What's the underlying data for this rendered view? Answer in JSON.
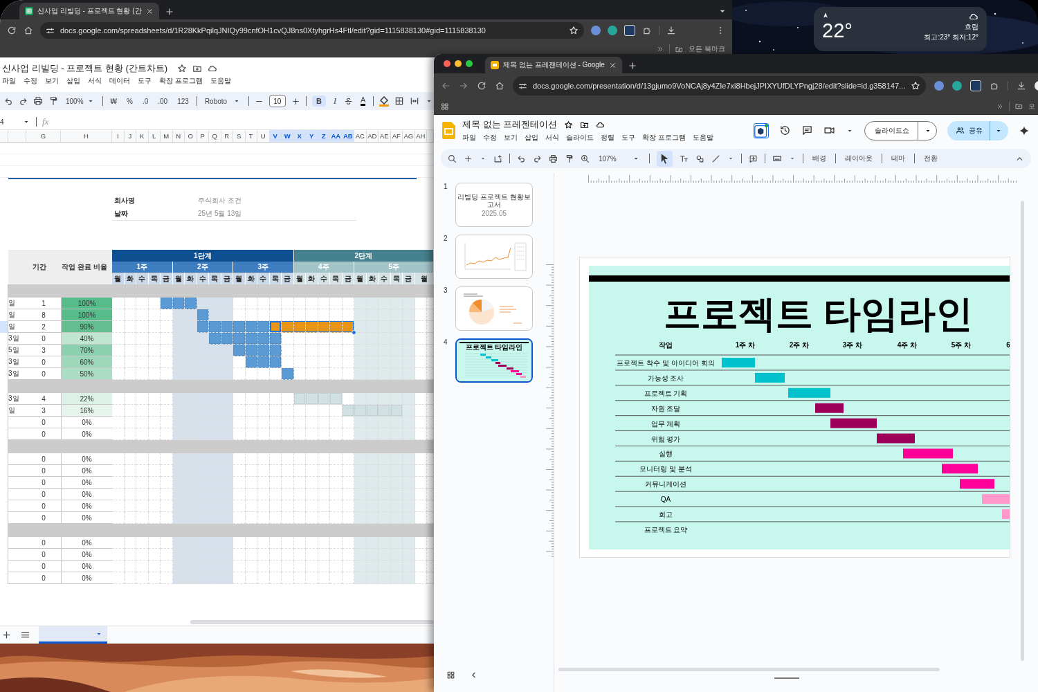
{
  "desktop": {
    "weather": {
      "temperature": "22°",
      "condition": "흐림",
      "range": "최고:23° 최저:12°"
    }
  },
  "sheets_window": {
    "tab_title": "신사업 리빌딩 - 프로젝트 현황 (간",
    "url": "docs.google.com/spreadsheets/d/1R28KkPqilqJNIQy99cnfOH1cvQJ8ns0XtyhgrHs4Ftl/edit?gid=1115838130#gid=1115838130",
    "bookmarks": "모든 북마크",
    "doc_title": "신사업 리빌딩 - 프로젝트 현황 (간트차트)",
    "menu": [
      "파일",
      "수정",
      "보기",
      "삽입",
      "서식",
      "데이터",
      "도구",
      "확장 프로그램",
      "도움말"
    ],
    "toolbar": {
      "zoom": "100%",
      "currency": "₩",
      "percent": "%",
      "decimal_decrease": ".0",
      "decimal_increase": ".00",
      "number_format": "123",
      "font": "Roboto",
      "font_size": "10",
      "bold": {
        "label": "B",
        "selected": true
      },
      "italic": {
        "label": "I",
        "selected": false
      },
      "text_color": "A"
    },
    "cell_ref": "4",
    "formula_label": "fx",
    "columns": [
      {
        "label": "G",
        "selected": false
      },
      {
        "label": "H",
        "selected": false
      },
      {
        "label": "I",
        "selected": false
      },
      {
        "label": "J",
        "selected": false
      },
      {
        "label": "K",
        "selected": false
      },
      {
        "label": "L",
        "selected": false
      },
      {
        "label": "M",
        "selected": false
      },
      {
        "label": "N",
        "selected": false
      },
      {
        "label": "O",
        "selected": false
      },
      {
        "label": "P",
        "selected": false
      },
      {
        "label": "Q",
        "selected": false
      },
      {
        "label": "R",
        "selected": false
      },
      {
        "label": "S",
        "selected": false
      },
      {
        "label": "T",
        "selected": false
      },
      {
        "label": "U",
        "selected": false
      },
      {
        "label": "V",
        "selected": true
      },
      {
        "label": "W",
        "selected": true
      },
      {
        "label": "X",
        "selected": true
      },
      {
        "label": "Y",
        "selected": true
      },
      {
        "label": "Z",
        "selected": true
      },
      {
        "label": "AA",
        "selected": true
      },
      {
        "label": "AB",
        "selected": true
      },
      {
        "label": "AC",
        "selected": false
      },
      {
        "label": "AD",
        "selected": false
      },
      {
        "label": "AE",
        "selected": false
      },
      {
        "label": "AF",
        "selected": false
      },
      {
        "label": "AG",
        "selected": false
      },
      {
        "label": "AH",
        "selected": false
      }
    ],
    "info": [
      {
        "label": "회사명",
        "value": "주식회사 조건"
      },
      {
        "label": "날짜",
        "value": "25년 5월 13일"
      }
    ],
    "gantt": {
      "duration_header": "기간",
      "progress_header": "작업 완료 비율",
      "phases": [
        {
          "label": "1단계",
          "color": "#0d4f91",
          "weeks": [
            {
              "label": "1주",
              "color": "#3d7dc0",
              "highlighted": false,
              "days": [
                "월",
                "화",
                "수",
                "목",
                "금"
              ]
            },
            {
              "label": "2주",
              "color": "#3d7dc0",
              "highlighted": true,
              "days": [
                "월",
                "화",
                "수",
                "목",
                "금"
              ]
            },
            {
              "label": "3주",
              "color": "#3d7dc0",
              "highlighted": false,
              "days": [
                "월",
                "화",
                "수",
                "목",
                "금"
              ]
            }
          ]
        },
        {
          "label": "2단계",
          "color": "#45818e",
          "weeks": [
            {
              "label": "4주",
              "color": "#a2c4c9",
              "highlighted": false,
              "days": [
                "월",
                "화",
                "수",
                "목",
                "금"
              ]
            },
            {
              "label": "5주",
              "color": "#a2c4c9",
              "highlighted": true,
              "days": [
                "월",
                "화",
                "수",
                "목",
                "금"
              ]
            },
            {
              "highlighted": false,
              "days": [
                "월"
              ]
            }
          ]
        }
      ],
      "rows": [
        {
          "kind": "section"
        },
        {
          "kind": "task",
          "date": "일",
          "duration": "1",
          "percent": "100%",
          "color": "#57bb8a",
          "selected": false,
          "cells": [
            {
              "filled": false
            },
            {
              "filled": false
            },
            {
              "filled": false
            },
            {
              "filled": false
            },
            {
              "filled": true,
              "color": "#5b9bd5"
            },
            {
              "filled": true,
              "color": "#5b9bd5"
            },
            {
              "filled": true,
              "color": "#5b9bd5"
            },
            {
              "filled": false
            },
            {
              "filled": false
            },
            {
              "filled": false
            },
            {
              "filled": false
            },
            {
              "filled": false
            },
            {
              "filled": false
            },
            {
              "filled": false
            },
            {
              "filled": false
            },
            {
              "filled": false
            },
            {
              "filled": false
            },
            {
              "filled": false
            },
            {
              "filled": false
            },
            {
              "filled": false
            },
            {
              "filled": false
            },
            {
              "filled": false
            },
            {
              "filled": false
            },
            {
              "filled": false
            },
            {
              "filled": false
            },
            {
              "filled": false
            }
          ]
        },
        {
          "kind": "task",
          "date": "일",
          "duration": "8",
          "percent": "100%",
          "color": "#57bb8a",
          "selected": false,
          "cells": [
            {
              "filled": false
            },
            {
              "filled": false
            },
            {
              "filled": false
            },
            {
              "filled": false
            },
            {
              "filled": false
            },
            {
              "filled": false
            },
            {
              "filled": false
            },
            {
              "filled": true,
              "color": "#5b9bd5"
            },
            {
              "filled": false
            },
            {
              "filled": false
            },
            {
              "filled": false
            },
            {
              "filled": false
            },
            {
              "filled": false
            },
            {
              "filled": false
            },
            {
              "filled": false
            },
            {
              "filled": false
            },
            {
              "filled": false
            },
            {
              "filled": false
            },
            {
              "filled": false
            },
            {
              "filled": false
            },
            {
              "filled": false
            },
            {
              "filled": false
            },
            {
              "filled": false
            },
            {
              "filled": false
            },
            {
              "filled": false
            },
            {
              "filled": false
            }
          ]
        },
        {
          "kind": "task",
          "date": "일",
          "duration": "2",
          "percent": "90%",
          "color": "#63be8f",
          "selected": true,
          "cells": [
            {
              "filled": false
            },
            {
              "filled": false
            },
            {
              "filled": false
            },
            {
              "filled": false
            },
            {
              "filled": false
            },
            {
              "filled": false
            },
            {
              "filled": false
            },
            {
              "filled": true,
              "color": "#5b9bd5"
            },
            {
              "filled": true,
              "color": "#5b9bd5"
            },
            {
              "filled": true,
              "color": "#5b9bd5"
            },
            {
              "filled": true,
              "color": "#5b9bd5"
            },
            {
              "filled": true,
              "color": "#5b9bd5"
            },
            {
              "filled": true,
              "color": "#5b9bd5"
            },
            {
              "filled": true,
              "color": "#e69519"
            },
            {
              "filled": true,
              "color": "#e69519"
            },
            {
              "filled": true,
              "color": "#e69519"
            },
            {
              "filled": true,
              "color": "#e69519"
            },
            {
              "filled": true,
              "color": "#e69519"
            },
            {
              "filled": true,
              "color": "#e69519"
            },
            {
              "filled": true,
              "color": "#e69519"
            },
            {
              "filled": false
            },
            {
              "filled": false
            },
            {
              "filled": false
            },
            {
              "filled": false
            },
            {
              "filled": false
            },
            {
              "filled": false
            }
          ]
        },
        {
          "kind": "task",
          "date": "3일",
          "duration": "0",
          "percent": "40%",
          "color": "#c0e6d2",
          "selected": false,
          "cells": [
            {
              "filled": false
            },
            {
              "filled": false
            },
            {
              "filled": false
            },
            {
              "filled": false
            },
            {
              "filled": false
            },
            {
              "filled": false
            },
            {
              "filled": false
            },
            {
              "filled": false
            },
            {
              "filled": true,
              "color": "#5b9bd5"
            },
            {
              "filled": true,
              "color": "#5b9bd5"
            },
            {
              "filled": true,
              "color": "#5b9bd5"
            },
            {
              "filled": true,
              "color": "#5b9bd5"
            },
            {
              "filled": true,
              "color": "#5b9bd5"
            },
            {
              "filled": true,
              "color": "#5b9bd5"
            },
            {
              "filled": false
            },
            {
              "filled": false
            },
            {
              "filled": false
            },
            {
              "filled": false
            },
            {
              "filled": false
            },
            {
              "filled": false
            },
            {
              "filled": false
            },
            {
              "filled": false
            },
            {
              "filled": false
            },
            {
              "filled": false
            },
            {
              "filled": false
            },
            {
              "filled": false
            }
          ]
        },
        {
          "kind": "task",
          "date": "5일",
          "duration": "3",
          "percent": "70%",
          "color": "#8bd0af",
          "selected": false,
          "cells": [
            {
              "filled": false
            },
            {
              "filled": false
            },
            {
              "filled": false
            },
            {
              "filled": false
            },
            {
              "filled": false
            },
            {
              "filled": false
            },
            {
              "filled": false
            },
            {
              "filled": false
            },
            {
              "filled": false
            },
            {
              "filled": false
            },
            {
              "filled": true,
              "color": "#5b9bd5"
            },
            {
              "filled": true,
              "color": "#5b9bd5"
            },
            {
              "filled": true,
              "color": "#5b9bd5"
            },
            {
              "filled": true,
              "color": "#5b9bd5"
            },
            {
              "filled": false
            },
            {
              "filled": false
            },
            {
              "filled": false
            },
            {
              "filled": false
            },
            {
              "filled": false
            },
            {
              "filled": false
            },
            {
              "filled": false
            },
            {
              "filled": false
            },
            {
              "filled": false
            },
            {
              "filled": false
            },
            {
              "filled": false
            },
            {
              "filled": false
            }
          ]
        },
        {
          "kind": "task",
          "date": "3일",
          "duration": "0",
          "percent": "60%",
          "color": "#9dd8bb",
          "selected": false,
          "cells": [
            {
              "filled": false
            },
            {
              "filled": false
            },
            {
              "filled": false
            },
            {
              "filled": false
            },
            {
              "filled": false
            },
            {
              "filled": false
            },
            {
              "filled": false
            },
            {
              "filled": false
            },
            {
              "filled": false
            },
            {
              "filled": false
            },
            {
              "filled": false
            },
            {
              "filled": true,
              "color": "#5b9bd5"
            },
            {
              "filled": true,
              "color": "#5b9bd5"
            },
            {
              "filled": true,
              "color": "#5b9bd5"
            },
            {
              "filled": false
            },
            {
              "filled": false
            },
            {
              "filled": false
            },
            {
              "filled": false
            },
            {
              "filled": false
            },
            {
              "filled": false
            },
            {
              "filled": false
            },
            {
              "filled": false
            },
            {
              "filled": false
            },
            {
              "filled": false
            },
            {
              "filled": false
            },
            {
              "filled": false
            }
          ]
        },
        {
          "kind": "task",
          "date": "3일",
          "duration": "0",
          "percent": "50%",
          "color": "#acdec5",
          "selected": false,
          "cells": [
            {
              "filled": false
            },
            {
              "filled": false
            },
            {
              "filled": false
            },
            {
              "filled": false
            },
            {
              "filled": false
            },
            {
              "filled": false
            },
            {
              "filled": false
            },
            {
              "filled": false
            },
            {
              "filled": false
            },
            {
              "filled": false
            },
            {
              "filled": false
            },
            {
              "filled": false
            },
            {
              "filled": false
            },
            {
              "filled": false
            },
            {
              "filled": true,
              "color": "#5b9bd5"
            },
            {
              "filled": false
            },
            {
              "filled": false
            },
            {
              "filled": false
            },
            {
              "filled": false
            },
            {
              "filled": false
            },
            {
              "filled": false
            },
            {
              "filled": false
            },
            {
              "filled": false
            },
            {
              "filled": false
            },
            {
              "filled": false
            },
            {
              "filled": false
            }
          ]
        },
        {
          "kind": "section"
        },
        {
          "kind": "task",
          "date": "3일",
          "duration": "4",
          "percent": "22%",
          "color": "#ddf2e6",
          "selected": false,
          "cells": [
            {
              "filled": false
            },
            {
              "filled": false
            },
            {
              "filled": false
            },
            {
              "filled": false
            },
            {
              "filled": false
            },
            {
              "filled": false
            },
            {
              "filled": false
            },
            {
              "filled": false
            },
            {
              "filled": false
            },
            {
              "filled": false
            },
            {
              "filled": false
            },
            {
              "filled": false
            },
            {
              "filled": false
            },
            {
              "filled": false
            },
            {
              "filled": false
            },
            {
              "filled": true,
              "color": "#d0e0e3"
            },
            {
              "filled": true,
              "color": "#d0e0e3"
            },
            {
              "filled": true,
              "color": "#d0e0e3"
            },
            {
              "filled": true,
              "color": "#d0e0e3"
            },
            {
              "filled": false
            },
            {
              "filled": false
            },
            {
              "filled": false
            },
            {
              "filled": false
            },
            {
              "filled": false
            },
            {
              "filled": false
            },
            {
              "filled": false
            }
          ]
        },
        {
          "kind": "task",
          "date": "일",
          "duration": "3",
          "percent": "16%",
          "color": "#e5f5ec",
          "selected": false,
          "cells": [
            {
              "filled": false
            },
            {
              "filled": false
            },
            {
              "filled": false
            },
            {
              "filled": false
            },
            {
              "filled": false
            },
            {
              "filled": false
            },
            {
              "filled": false
            },
            {
              "filled": false
            },
            {
              "filled": false
            },
            {
              "filled": false
            },
            {
              "filled": false
            },
            {
              "filled": false
            },
            {
              "filled": false
            },
            {
              "filled": false
            },
            {
              "filled": false
            },
            {
              "filled": false
            },
            {
              "filled": false
            },
            {
              "filled": false
            },
            {
              "filled": false
            },
            {
              "filled": true,
              "color": "#d0e0e3"
            },
            {
              "filled": true,
              "color": "#d0e0e3"
            },
            {
              "filled": true,
              "color": "#d0e0e3"
            },
            {
              "filled": true,
              "color": "#d0e0e3"
            },
            {
              "filled": true,
              "color": "#d0e0e3"
            },
            {
              "filled": false
            },
            {
              "filled": false
            }
          ]
        },
        {
          "kind": "task",
          "duration": "0",
          "percent": "0%",
          "selected": false
        },
        {
          "kind": "task",
          "duration": "0",
          "percent": "0%",
          "selected": false
        },
        {
          "kind": "section"
        },
        {
          "kind": "task",
          "duration": "0",
          "percent": "0%",
          "selected": false
        },
        {
          "kind": "task",
          "duration": "0",
          "percent": "0%",
          "selected": false
        },
        {
          "kind": "task",
          "duration": "0",
          "percent": "0%",
          "selected": false
        },
        {
          "kind": "task",
          "duration": "0",
          "percent": "0%",
          "selected": false
        },
        {
          "kind": "task",
          "duration": "0",
          "percent": "0%",
          "selected": false
        },
        {
          "kind": "task",
          "duration": "0",
          "percent": "0%",
          "selected": false
        },
        {
          "kind": "section"
        },
        {
          "kind": "task",
          "duration": "0",
          "percent": "0%",
          "selected": false
        },
        {
          "kind": "task",
          "duration": "0",
          "percent": "0%",
          "selected": false
        },
        {
          "kind": "task",
          "duration": "0",
          "percent": "0%",
          "selected": false
        },
        {
          "kind": "task",
          "duration": "0",
          "percent": "0%",
          "selected": false
        }
      ]
    },
    "sheet_tabs": [
      {
        "selected": true
      }
    ]
  },
  "slides_window": {
    "tab_title": "제목 없는 프레젠테이션 - Google",
    "url": "docs.google.com/presentation/d/13gjumo9VoNCAj8y4ZIe7xi8HbejJPIXYUfDLYPngj28/edit?slide=id.g358147...",
    "bookmarks": "모",
    "doc_title": "제목 없는 프레젠테이션",
    "menu": [
      "파일",
      "수정",
      "보기",
      "삽입",
      "서식",
      "슬라이드",
      "정렬",
      "도구",
      "확장 프로그램",
      "도움말"
    ],
    "slideshow_button": "슬라이드쇼",
    "share_button": "공유",
    "toolbar": {
      "zoom": "107%",
      "actions": [
        "배경",
        "레이아웃",
        "테마",
        "전환"
      ]
    },
    "slides": [
      {
        "number": "1",
        "kind": "title",
        "title": "리빌딩 프로젝트 현황보고서",
        "subtitle": "2025.05",
        "selected": false
      },
      {
        "number": "2",
        "kind": "line-chart",
        "selected": false
      },
      {
        "number": "3",
        "kind": "pie-chart",
        "selected": false
      },
      {
        "number": "4",
        "kind": "timeline",
        "title": "프로젝트 타임라인",
        "selected": true
      }
    ],
    "slide": {
      "title": "프로젝트 타임라인",
      "task_header": "작업",
      "weeks": [
        "1주 차",
        "2주 차",
        "3주 차",
        "4주 차",
        "5주 차",
        "6"
      ],
      "tasks": [
        "프로젝트 착수 및 아이디어 회의",
        "가능성 조사",
        "프로젝트 기획",
        "자원 조달",
        "업무 계획",
        "위험 평가",
        "실행",
        "모니터링 및 분석",
        "커뮤니케이션",
        "QA",
        "회고",
        "프로젝트 요약"
      ]
    }
  }
}
